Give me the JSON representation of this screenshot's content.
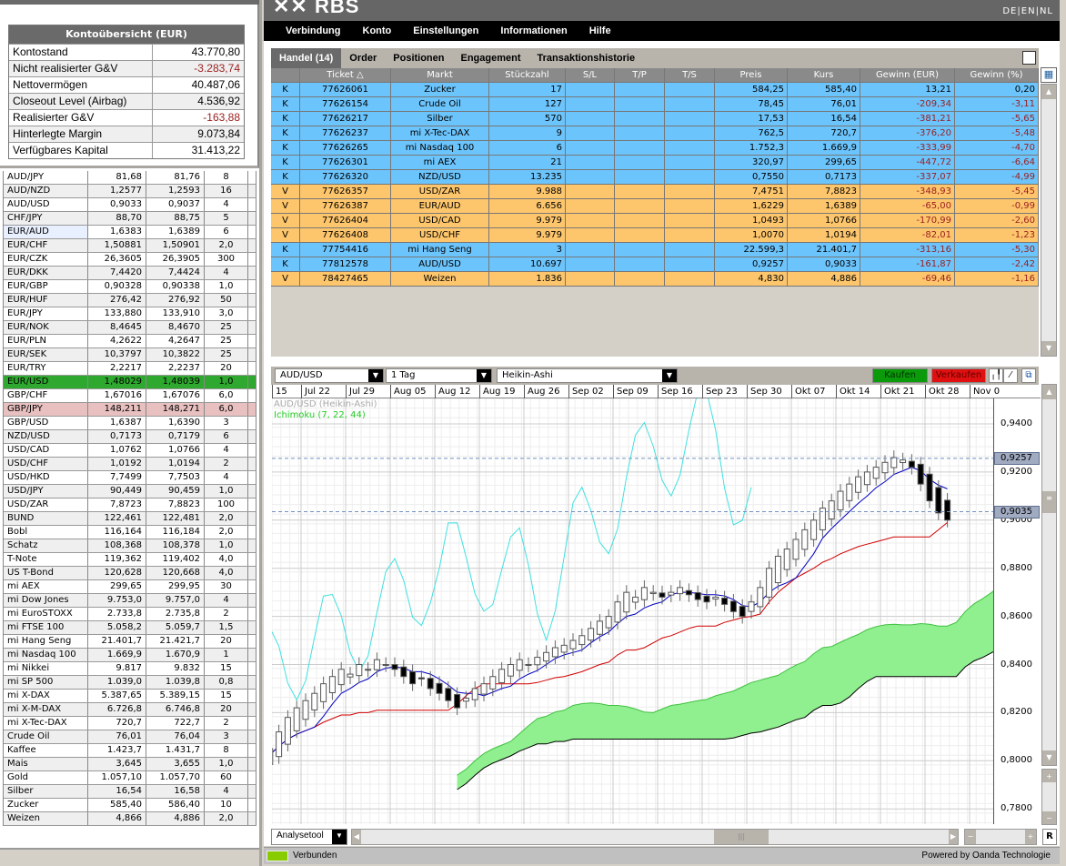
{
  "header": {
    "logo": "RBS",
    "languages": [
      "DE",
      "EN",
      "NL"
    ]
  },
  "nav": [
    "Verbindung",
    "Konto",
    "Einstellungen",
    "Informationen",
    "Hilfe"
  ],
  "account": {
    "title": "Kontoübersicht (EUR)",
    "rows": [
      {
        "label": "Kontostand",
        "value": "43.770,80",
        "neg": false
      },
      {
        "label": "Nicht realisierter G&V",
        "value": "-3.283,74",
        "neg": true
      },
      {
        "label": "Nettovermögen",
        "value": "40.487,06",
        "neg": false
      },
      {
        "label": "Closeout Level (Airbag)",
        "value": "4.536,92",
        "neg": false
      },
      {
        "label": "Realisierter G&V",
        "value": "-163,88",
        "neg": true
      },
      {
        "label": "Hinterlegte Margin",
        "value": "9.073,84",
        "neg": false
      },
      {
        "label": "Verfügbares Kapital",
        "value": "31.413,22",
        "neg": false
      }
    ]
  },
  "watchlist": [
    [
      "AUD/JPY",
      "81,68",
      "81,76",
      "8"
    ],
    [
      "AUD/NZD",
      "1,2577",
      "1,2593",
      "16"
    ],
    [
      "AUD/USD",
      "0,9033",
      "0,9037",
      "4"
    ],
    [
      "CHF/JPY",
      "88,70",
      "88,75",
      "5"
    ],
    [
      "EUR/AUD",
      "1,6383",
      "1,6389",
      "6"
    ],
    [
      "EUR/CHF",
      "1,50881",
      "1,50901",
      "2,0"
    ],
    [
      "EUR/CZK",
      "26,3605",
      "26,3905",
      "300"
    ],
    [
      "EUR/DKK",
      "7,4420",
      "7,4424",
      "4"
    ],
    [
      "EUR/GBP",
      "0,90328",
      "0,90338",
      "1,0"
    ],
    [
      "EUR/HUF",
      "276,42",
      "276,92",
      "50"
    ],
    [
      "EUR/JPY",
      "133,880",
      "133,910",
      "3,0"
    ],
    [
      "EUR/NOK",
      "8,4645",
      "8,4670",
      "25"
    ],
    [
      "EUR/PLN",
      "4,2622",
      "4,2647",
      "25"
    ],
    [
      "EUR/SEK",
      "10,3797",
      "10,3822",
      "25"
    ],
    [
      "EUR/TRY",
      "2,2217",
      "2,2237",
      "20"
    ],
    [
      "EUR/USD",
      "1,48029",
      "1,48039",
      "1,0"
    ],
    [
      "GBP/CHF",
      "1,67016",
      "1,67076",
      "6,0"
    ],
    [
      "GBP/JPY",
      "148,211",
      "148,271",
      "6,0"
    ],
    [
      "GBP/USD",
      "1,6387",
      "1,6390",
      "3"
    ],
    [
      "NZD/USD",
      "0,7173",
      "0,7179",
      "6"
    ],
    [
      "USD/CAD",
      "1,0762",
      "1,0766",
      "4"
    ],
    [
      "USD/CHF",
      "1,0192",
      "1,0194",
      "2"
    ],
    [
      "USD/HKD",
      "7,7499",
      "7,7503",
      "4"
    ],
    [
      "USD/JPY",
      "90,449",
      "90,459",
      "1,0"
    ],
    [
      "USD/ZAR",
      "7,8723",
      "7,8823",
      "100"
    ],
    [
      "BUND",
      "122,461",
      "122,481",
      "2,0"
    ],
    [
      "Bobl",
      "116,164",
      "116,184",
      "2,0"
    ],
    [
      "Schatz",
      "108,368",
      "108,378",
      "1,0"
    ],
    [
      "T-Note",
      "119,362",
      "119,402",
      "4,0"
    ],
    [
      "US T-Bond",
      "120,628",
      "120,668",
      "4,0"
    ],
    [
      "mi AEX",
      "299,65",
      "299,95",
      "30"
    ],
    [
      "mi Dow Jones",
      "9.753,0",
      "9.757,0",
      "4"
    ],
    [
      "mi EuroSTOXX",
      "2.733,8",
      "2.735,8",
      "2"
    ],
    [
      "mi FTSE 100",
      "5.058,2",
      "5.059,7",
      "1,5"
    ],
    [
      "mi Hang Seng",
      "21.401,7",
      "21.421,7",
      "20"
    ],
    [
      "mi Nasdaq 100",
      "1.669,9",
      "1.670,9",
      "1"
    ],
    [
      "mi Nikkei",
      "9.817",
      "9.832",
      "15"
    ],
    [
      "mi SP 500",
      "1.039,0",
      "1.039,8",
      "0,8"
    ],
    [
      "mi X-DAX",
      "5.387,65",
      "5.389,15",
      "15"
    ],
    [
      "mi X-M-DAX",
      "6.726,8",
      "6.746,8",
      "20"
    ],
    [
      "mi X-Tec-DAX",
      "720,7",
      "722,7",
      "2"
    ],
    [
      "Crude Oil",
      "76,01",
      "76,04",
      "3"
    ],
    [
      "Kaffee",
      "1.423,7",
      "1.431,7",
      "8"
    ],
    [
      "Mais",
      "3,645",
      "3,655",
      "1,0"
    ],
    [
      "Gold",
      "1.057,10",
      "1.057,70",
      "60"
    ],
    [
      "Silber",
      "16,54",
      "16,58",
      "4"
    ],
    [
      "Zucker",
      "585,40",
      "586,40",
      "10"
    ],
    [
      "Weizen",
      "4,866",
      "4,886",
      "2,0"
    ]
  ],
  "watch_highlight": {
    "up": "EUR/USD",
    "down": "GBP/JPY",
    "selected": "EUR/AUD",
    "up_color": "#2ea82e",
    "down_color": "#e8c0c0"
  },
  "tabs": [
    {
      "label": "Handel (14)",
      "active": true
    },
    {
      "label": "Order"
    },
    {
      "label": "Positionen"
    },
    {
      "label": "Engagement"
    },
    {
      "label": "Transaktionshistorie"
    }
  ],
  "trades": {
    "columns": [
      "",
      "Ticket △",
      "Markt",
      "Stückzahl",
      "S/L",
      "T/P",
      "T/S",
      "Preis",
      "Kurs",
      "Gewinn (EUR)",
      "Gewinn (%)"
    ],
    "rows": [
      [
        "K",
        "77626061",
        "Zucker",
        "17",
        "",
        "",
        "",
        "584,25",
        "585,40",
        "13,21",
        "0,20"
      ],
      [
        "K",
        "77626154",
        "Crude Oil",
        "127",
        "",
        "",
        "",
        "78,45",
        "76,01",
        "-209,34",
        "-3,11"
      ],
      [
        "K",
        "77626217",
        "Silber",
        "570",
        "",
        "",
        "",
        "17,53",
        "16,54",
        "-381,21",
        "-5,65"
      ],
      [
        "K",
        "77626237",
        "mi X-Tec-DAX",
        "9",
        "",
        "",
        "",
        "762,5",
        "720,7",
        "-376,20",
        "-5,48"
      ],
      [
        "K",
        "77626265",
        "mi Nasdaq 100",
        "6",
        "",
        "",
        "",
        "1.752,3",
        "1.669,9",
        "-333,99",
        "-4,70"
      ],
      [
        "K",
        "77626301",
        "mi AEX",
        "21",
        "",
        "",
        "",
        "320,97",
        "299,65",
        "-447,72",
        "-6,64"
      ],
      [
        "K",
        "77626320",
        "NZD/USD",
        "13.235",
        "",
        "",
        "",
        "0,7550",
        "0,7173",
        "-337,07",
        "-4,99"
      ],
      [
        "V",
        "77626357",
        "USD/ZAR",
        "9.988",
        "",
        "",
        "",
        "7,4751",
        "7,8823",
        "-348,93",
        "-5,45"
      ],
      [
        "V",
        "77626387",
        "EUR/AUD",
        "6.656",
        "",
        "",
        "",
        "1,6229",
        "1,6389",
        "-65,00",
        "-0,99"
      ],
      [
        "V",
        "77626404",
        "USD/CAD",
        "9.979",
        "",
        "",
        "",
        "1,0493",
        "1,0766",
        "-170,99",
        "-2,60"
      ],
      [
        "V",
        "77626408",
        "USD/CHF",
        "9.979",
        "",
        "",
        "",
        "1,0070",
        "1,0194",
        "-82,01",
        "-1,23"
      ],
      [
        "K",
        "77754416",
        "mi Hang Seng",
        "3",
        "",
        "",
        "",
        "22.599,3",
        "21.401,7",
        "-313,16",
        "-5,30"
      ],
      [
        "K",
        "77812578",
        "AUD/USD",
        "10.697",
        "",
        "",
        "",
        "0,9257",
        "0,9033",
        "-161,87",
        "-2,42"
      ],
      [
        "V",
        "78427465",
        "Weizen",
        "1.836",
        "",
        "",
        "",
        "4,830",
        "4,886",
        "-69,46",
        "-1,16"
      ]
    ]
  },
  "chart_toolbar": {
    "instrument": "AUD/USD",
    "interval": "1 Tag",
    "chart_type": "Heikin-Ashi",
    "buy": "Kaufen",
    "sell": "Verkaufen",
    "analysis": "Analysetool",
    "reset": "R"
  },
  "chart_data": {
    "type": "candlestick",
    "title": "AUD/USD (Heikin-Ashi)",
    "indicator": "Ichimoku (7, 22, 44)",
    "ichimoku_periods": [
      7,
      22,
      44
    ],
    "x_ticks": [
      "15",
      "Jul 22",
      "Jul 29",
      "Aug 05",
      "Aug 12",
      "Aug 19",
      "Aug 26",
      "Sep 02",
      "Sep 09",
      "Sep 16",
      "Sep 23",
      "Sep 30",
      "Okt 07",
      "Okt 14",
      "Okt 21",
      "Okt 28",
      "Nov 0"
    ],
    "y_ticks": [
      "0,9400",
      "0,9200",
      "0,9000",
      "0,8800",
      "0,8600",
      "0,8400",
      "0,8200",
      "0,8000",
      "0,7800"
    ],
    "ylim": [
      0.775,
      0.9476
    ],
    "price_markers": [
      {
        "label": "0,9257",
        "value": 0.9257
      },
      {
        "label": "0,9035",
        "value": 0.9035
      }
    ],
    "closes": [
      0.8,
      0.805,
      0.812,
      0.818,
      0.822,
      0.825,
      0.828,
      0.832,
      0.835,
      0.838,
      0.836,
      0.84,
      0.838,
      0.842,
      0.84,
      0.838,
      0.835,
      0.832,
      0.834,
      0.83,
      0.828,
      0.825,
      0.822,
      0.826,
      0.83,
      0.832,
      0.835,
      0.838,
      0.84,
      0.842,
      0.84,
      0.843,
      0.845,
      0.847,
      0.848,
      0.85,
      0.852,
      0.855,
      0.858,
      0.86,
      0.866,
      0.87,
      0.868,
      0.872,
      0.87,
      0.868,
      0.87,
      0.872,
      0.869,
      0.867,
      0.866,
      0.868,
      0.865,
      0.862,
      0.86,
      0.866,
      0.872,
      0.88,
      0.885,
      0.888,
      0.892,
      0.896,
      0.9,
      0.905,
      0.908,
      0.912,
      0.915,
      0.918,
      0.92,
      0.922,
      0.924,
      0.926,
      0.925,
      0.922,
      0.915,
      0.908,
      0.903,
      0.9
    ],
    "colors": {
      "tenkan": "#0000c0",
      "kijun": "#d00000",
      "chikou": "#40e0e0",
      "cloud": "#90f090"
    }
  },
  "status": {
    "connection": "Verbunden",
    "powered": "Powered by Oanda Technologie",
    "led_color": "#88cc00"
  }
}
